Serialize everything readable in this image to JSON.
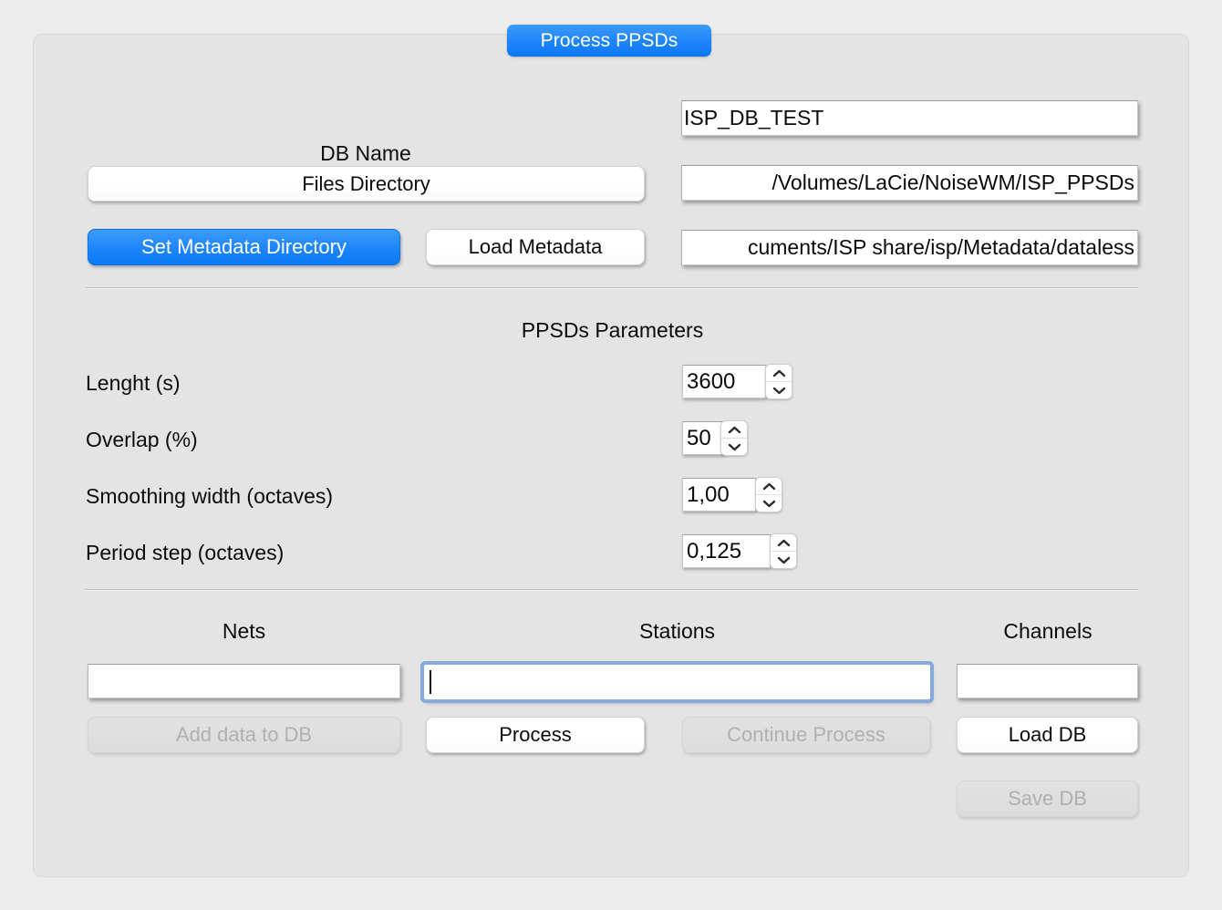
{
  "window": {
    "background_color": "#ececec",
    "panel_color": "#e4e4e4",
    "accent_color": "#1f86fa"
  },
  "tab": {
    "label": "Process PPSDs",
    "selected": true
  },
  "top_section": {
    "db_name_label": "DB Name",
    "db_name_value": "ISP_DB_TEST",
    "files_directory_button": "Files Directory",
    "files_directory_value": "/Volumes/LaCie/NoiseWM/ISP_PPSDs",
    "set_metadata_button": "Set Metadata Directory",
    "load_metadata_button": "Load Metadata",
    "metadata_directory_value": "cuments/ISP share/isp/Metadata/dataless"
  },
  "parameters": {
    "heading": "PPSDs Parameters",
    "rows": [
      {
        "label": "Lenght (s)",
        "value": "3600"
      },
      {
        "label": "Overlap (%)",
        "value": "50"
      },
      {
        "label": "Smoothing width (octaves)",
        "value": "1,00"
      },
      {
        "label": "Period step (octaves)",
        "value": "0,125"
      }
    ]
  },
  "selection": {
    "nets_label": "Nets",
    "nets_value": "",
    "stations_label": "Stations",
    "stations_value": "",
    "channels_label": "Channels",
    "channels_value": ""
  },
  "actions": {
    "add_data_to_db": "Add data to DB",
    "add_data_to_db_enabled": false,
    "process": "Process",
    "process_enabled": true,
    "continue_process": "Continue Process",
    "continue_process_enabled": false,
    "load_db": "Load DB",
    "load_db_enabled": true,
    "save_db": "Save DB",
    "save_db_enabled": false
  }
}
